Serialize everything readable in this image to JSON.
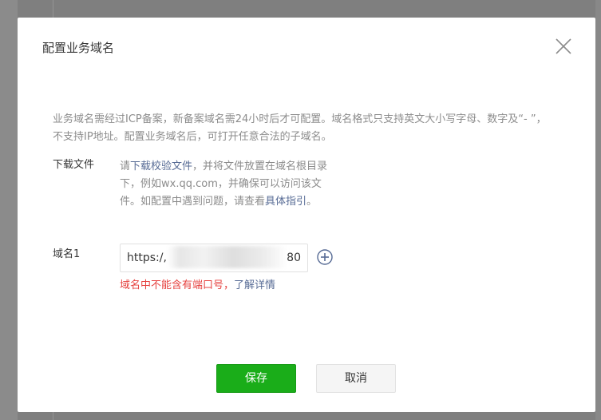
{
  "dialog": {
    "title": "配置业务域名",
    "description": "业务域名需经过ICP备案，新备案域名需24小时后才可配置。域名格式只支持英文大小写字母、数字及“- ”，不支持IP地址。配置业务域名后，可打开任意合法的子域名。"
  },
  "download": {
    "label": "下载文件",
    "text_before": "请",
    "link_download": "下载校验文件",
    "text_middle": "，并将文件放置在域名根目录下，例如wx.qq.com，并确保可以访问该文件。如配置中遇到问题，请查看",
    "link_guide": "具体指引",
    "text_end": "。"
  },
  "domain": {
    "label": "域名1",
    "input_prefix": "https:/,",
    "input_suffix": "80",
    "error_text": "域名中不能含有端口号，",
    "error_link": "了解详情"
  },
  "buttons": {
    "save": "保存",
    "cancel": "取消"
  },
  "colors": {
    "primary": "#1aad19",
    "link": "#576b95",
    "error": "#e64340"
  },
  "icons": {
    "close": "close-icon",
    "add": "plus-circle-icon"
  }
}
